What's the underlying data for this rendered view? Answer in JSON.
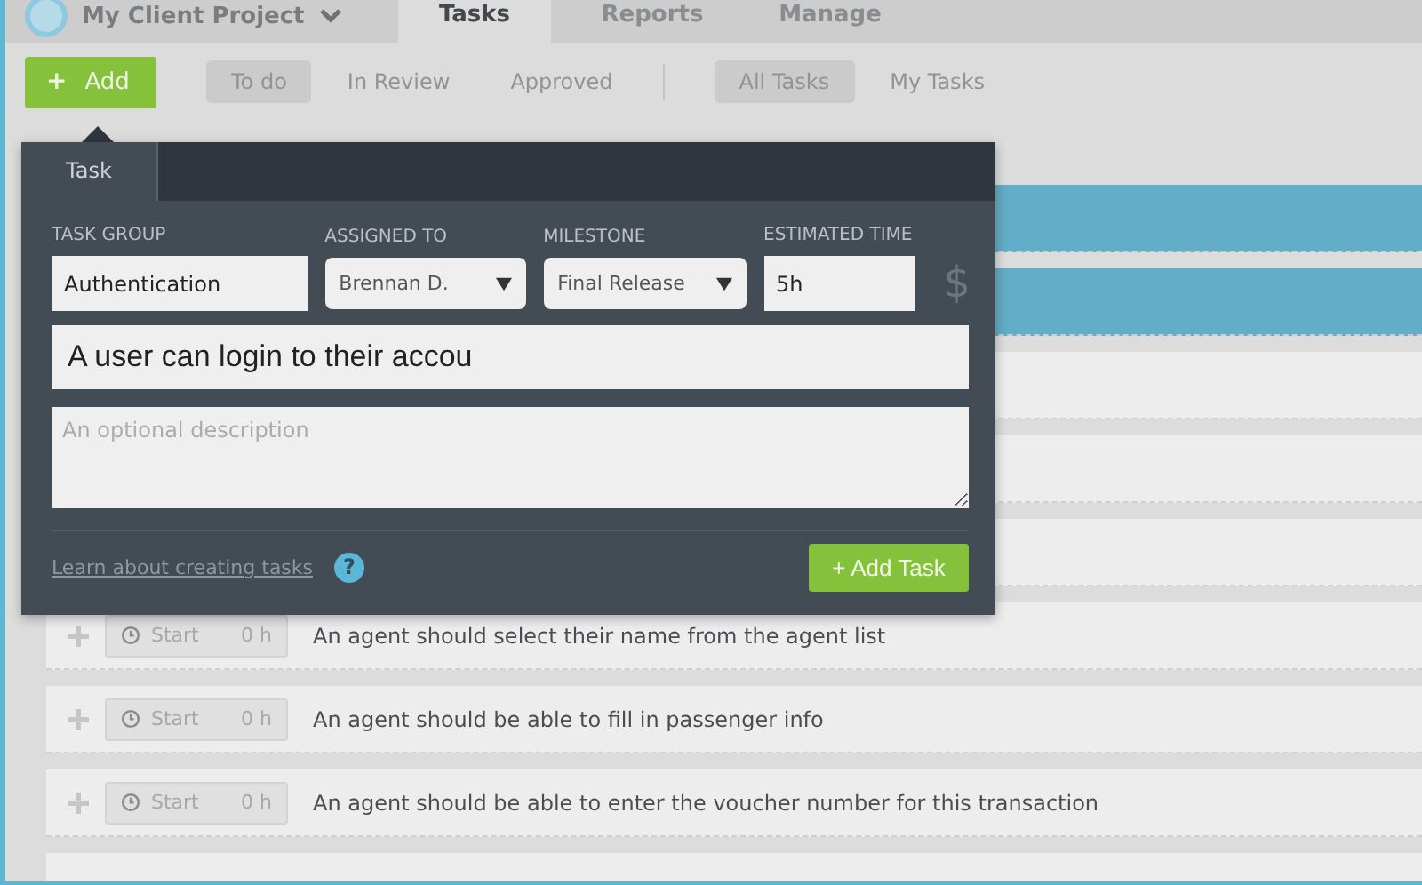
{
  "header": {
    "project": "My Client Project",
    "tabs": [
      {
        "label": "Tasks",
        "selected": true
      },
      {
        "label": "Reports",
        "selected": false
      },
      {
        "label": "Manage",
        "selected": false
      }
    ]
  },
  "toolbar": {
    "add_button": {
      "icon": "+",
      "label": "Add"
    },
    "status_filters": [
      {
        "label": "To do",
        "selected": true
      },
      {
        "label": "In Review",
        "selected": false
      },
      {
        "label": "Approved",
        "selected": false
      }
    ],
    "owner_filters": [
      {
        "label": "All Tasks",
        "selected": true
      },
      {
        "label": "My Tasks",
        "selected": false
      }
    ]
  },
  "tasks": [
    {
      "selected": true
    },
    {
      "selected": true
    },
    {
      "selected": false
    },
    {
      "selected": false
    },
    {
      "selected": false
    },
    {
      "selected": false,
      "start": "Start",
      "hours": "0 h",
      "title": "An agent should select their name from the agent list"
    },
    {
      "selected": false,
      "start": "Start",
      "hours": "0 h",
      "title": "An agent should be able to fill in passenger info"
    },
    {
      "selected": false,
      "start": "Start",
      "hours": "0 h",
      "title": "An agent should be able to enter the voucher number for this transaction"
    },
    {
      "selected": false
    }
  ],
  "task_form": {
    "tabs": [
      {
        "label": "Task",
        "selected": true
      }
    ],
    "fields": [
      {
        "kind": "text",
        "label": "TASK GROUP",
        "value": "Authentication"
      },
      {
        "kind": "select",
        "label": "ASSIGNED TO",
        "value": "Brennan D."
      },
      {
        "kind": "select",
        "label": "MILESTONE",
        "value": "Final Release"
      },
      {
        "kind": "text",
        "label": "ESTIMATED TIME",
        "value": "5h"
      }
    ],
    "currency": "$",
    "title": {
      "value": "A user can login to their accou"
    },
    "description": {
      "placeholder": "An optional description"
    },
    "help_link": "Learn about creating tasks",
    "help_icon": "?",
    "submit": "+ Add Task"
  }
}
